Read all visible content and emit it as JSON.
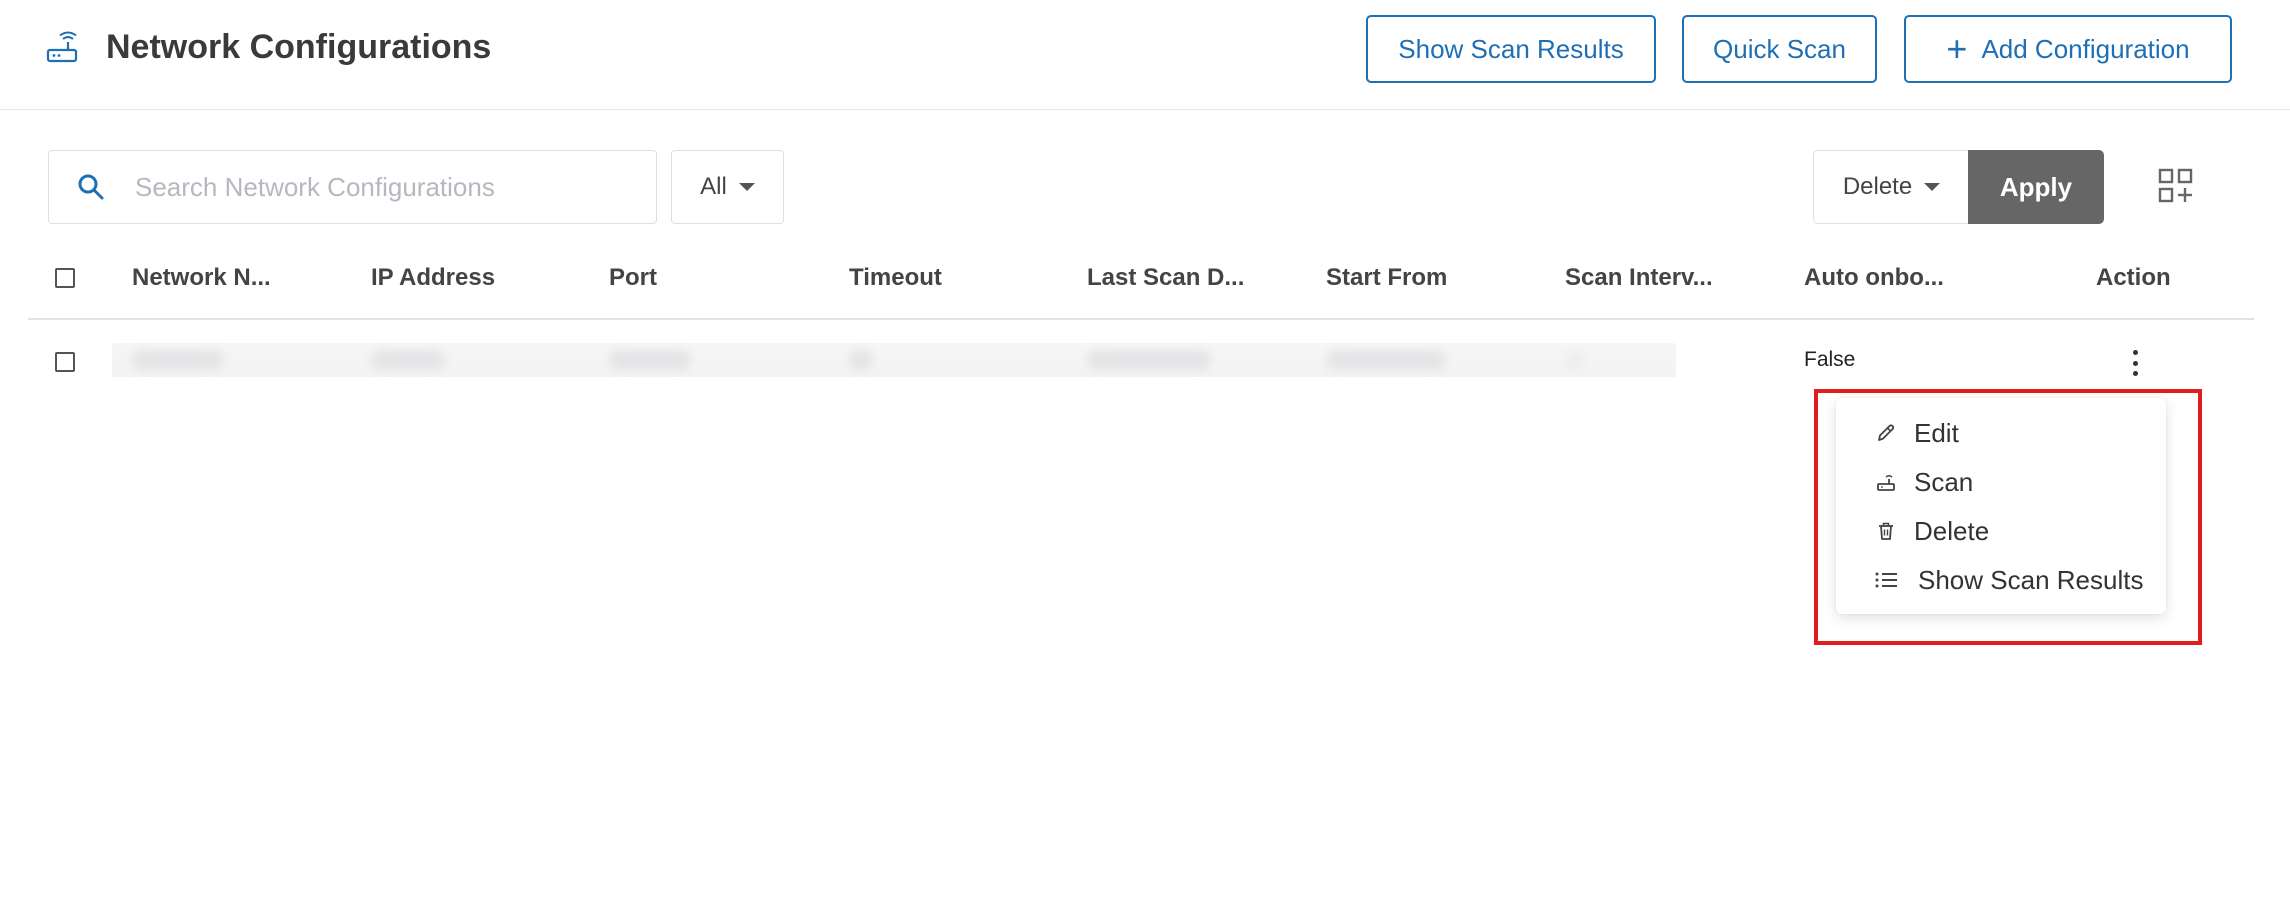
{
  "header": {
    "title": "Network Configurations",
    "icon": "network-router-icon",
    "buttons": {
      "show_scan_results": "Show Scan Results",
      "quick_scan": "Quick Scan",
      "add_configuration": "Add Configuration"
    }
  },
  "toolbar": {
    "search_placeholder": "Search Network Configurations",
    "filter_value": "All",
    "bulk_action_value": "Delete",
    "apply_label": "Apply",
    "view_toggle_icon": "grid-add-icon"
  },
  "table": {
    "columns": [
      "Network N...",
      "IP Address",
      "Port",
      "Timeout",
      "Last Scan D...",
      "Start From",
      "Scan Interv...",
      "Auto onbo...",
      "Action"
    ],
    "rows": [
      {
        "auto_onboard": "False"
      }
    ]
  },
  "action_menu": {
    "items": [
      {
        "label": "Edit",
        "icon": "pencil-icon"
      },
      {
        "label": "Scan",
        "icon": "scan-icon"
      },
      {
        "label": "Delete",
        "icon": "trash-icon"
      },
      {
        "label": "Show Scan Results",
        "icon": "list-icon"
      }
    ]
  },
  "colors": {
    "accent": "#1f6fb5",
    "apply_bg": "#666666",
    "highlight": "#e01e1e"
  }
}
